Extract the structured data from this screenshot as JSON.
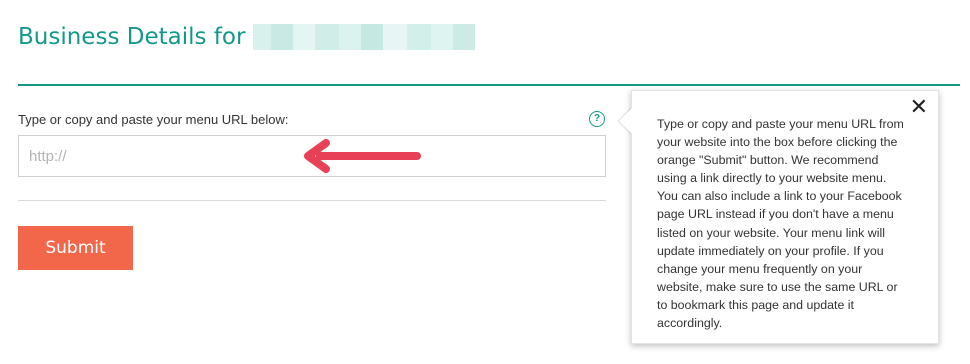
{
  "header": {
    "title": "Business Details for"
  },
  "form": {
    "url_label": "Type or copy and paste your menu URL below:",
    "url_placeholder": "http://",
    "url_value": "",
    "help_icon_glyph": "?",
    "submit_label": "Submit"
  },
  "tooltip": {
    "close_glyph": "✕",
    "text": "Type or copy and paste your menu URL from your website into the box before clicking the orange \"Submit\" button. We recommend using a link directly to your website menu. You can also include a link to your Facebook page URL instead if you don't have a menu listed on your website. Your menu link will update immediately on your profile. If you change your menu frequently on your website, make sure to use the same URL or to bookmark this page and update it accordingly."
  },
  "colors": {
    "accent_teal": "#13998a",
    "submit_orange": "#f2674a",
    "annotation_arrow_red": "#e84057"
  },
  "icons": {
    "help": "question-circle-icon",
    "close": "close-icon",
    "annotation": "left-arrow-icon"
  }
}
